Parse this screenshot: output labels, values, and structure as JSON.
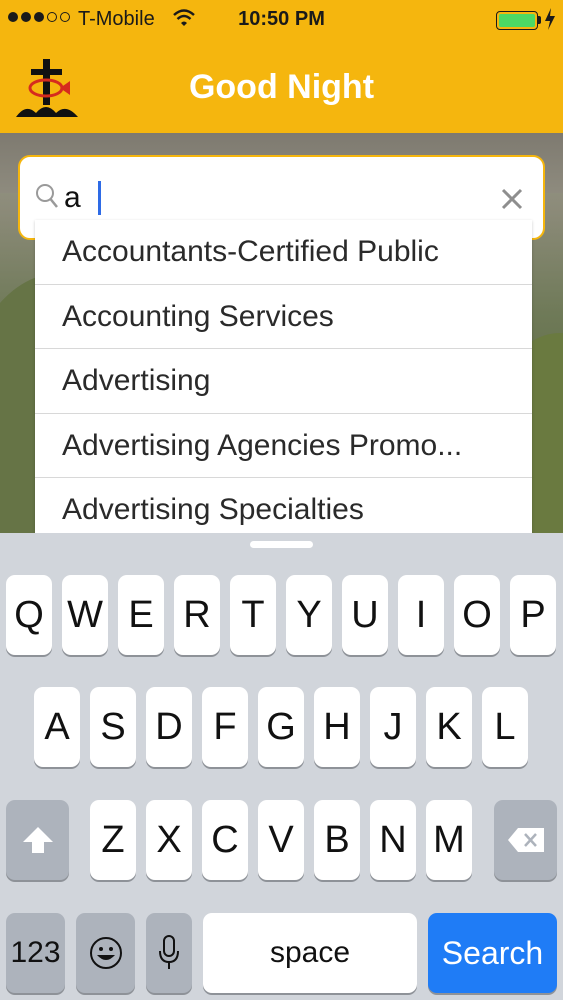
{
  "status_bar": {
    "carrier": "T-Mobile",
    "time": "10:50 PM",
    "battery_level": 1.0
  },
  "header": {
    "title": "Good Night",
    "logo_icon": "cross-fish-logo-icon",
    "background_color": "#f5b60e"
  },
  "search": {
    "value": "a",
    "icon": "search-icon",
    "clear_icon": "close-icon"
  },
  "suggestions": [
    "Accountants-Certified Public",
    "Accounting Services",
    "Advertising",
    "Advertising Agencies Promo...",
    "Advertising Specialties"
  ],
  "keyboard": {
    "row1": [
      "Q",
      "W",
      "E",
      "R",
      "T",
      "Y",
      "U",
      "I",
      "O",
      "P"
    ],
    "row2": [
      "A",
      "S",
      "D",
      "F",
      "G",
      "H",
      "J",
      "K",
      "L"
    ],
    "row3": [
      "Z",
      "X",
      "C",
      "V",
      "B",
      "N",
      "M"
    ],
    "numbers_label": "123",
    "space_label": "space",
    "search_label": "Search",
    "accent_color": "#1f7cf6"
  }
}
